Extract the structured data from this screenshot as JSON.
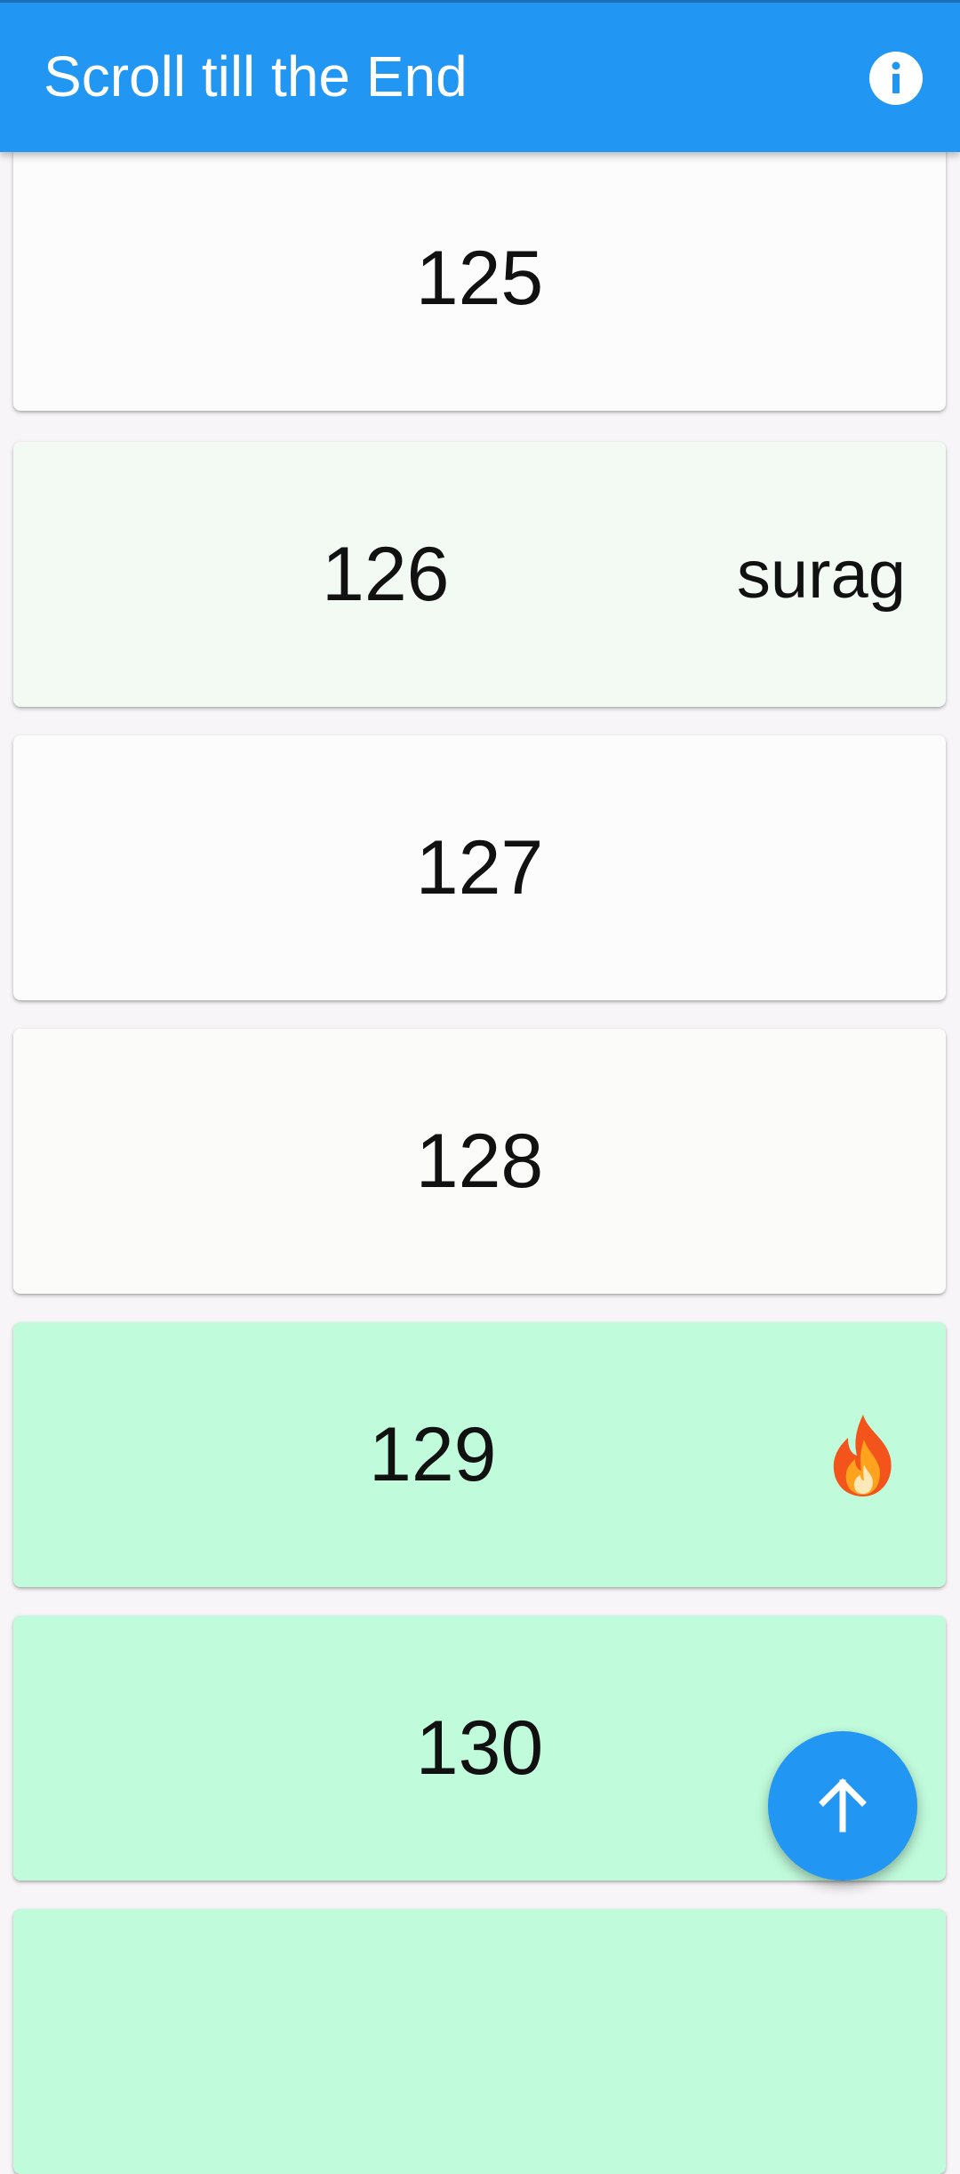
{
  "appbar": {
    "title": "Scroll till the End",
    "background": "#2196f3",
    "info_icon": "info-icon"
  },
  "items": [
    {
      "number": "125",
      "tag": "",
      "background": "#fbfcfb"
    },
    {
      "number": "126",
      "tag": "surag",
      "background": "#f3faf3"
    },
    {
      "number": "127",
      "tag": "",
      "background": "#fbfcfb"
    },
    {
      "number": "128",
      "tag": "",
      "background": "#fbfcfa"
    },
    {
      "number": "129",
      "tag": "",
      "icon": "fire-icon",
      "background": "#c0fcdc"
    },
    {
      "number": "130",
      "tag": "",
      "background": "#c0fcdc"
    },
    {
      "number": "",
      "tag": "",
      "background": "#c0fcdc"
    }
  ],
  "fab": {
    "icon": "arrow-up-icon",
    "background": "#2196f3"
  }
}
